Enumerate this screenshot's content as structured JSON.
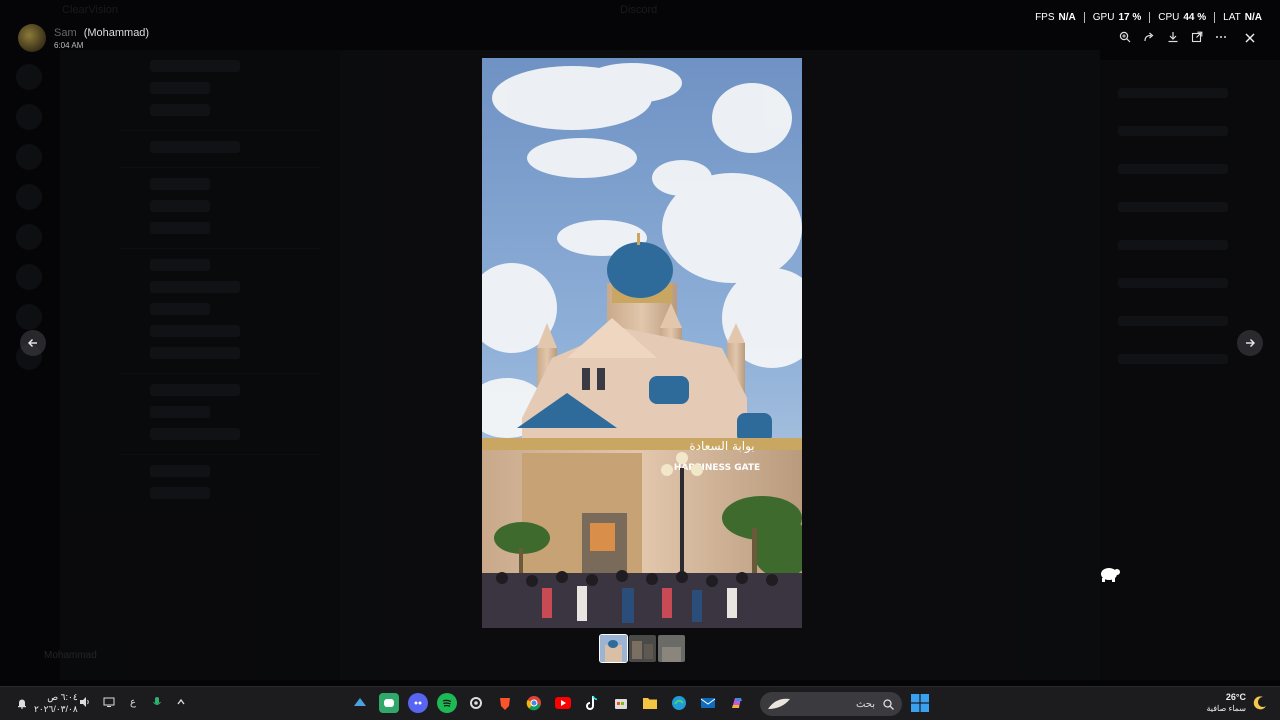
{
  "background_app": {
    "title": "ClearVision",
    "center_title": "Discord",
    "bottom_user": "Mohammad"
  },
  "user": {
    "handle": "Sam",
    "name": "(Mohammad)",
    "time": "6:04 AM"
  },
  "perf": {
    "fps_label": "FPS",
    "fps_value": "N/A",
    "gpu_label": "GPU",
    "gpu_value": "17 %",
    "cpu_label": "CPU",
    "cpu_value": "44 %",
    "lat_label": "LAT",
    "lat_value": "N/A"
  },
  "toolbar": {
    "zoom_icon": "zoom-in-icon",
    "forward_icon": "forward-icon",
    "download_icon": "download-icon",
    "open_icon": "open-external-icon",
    "more_icon": "more-icon",
    "close_icon": "close-icon"
  },
  "image": {
    "sign_text": "بوابة السعادة",
    "gate_text": "HAPPINESS GATE"
  },
  "thumbnails": [
    "thumb-1",
    "thumb-2",
    "thumb-3"
  ],
  "taskbar": {
    "time": "٦:٠٤ ص",
    "date": "٢٠٢٦/٠٣/٠٨",
    "lang": "ع",
    "search_placeholder": "بحث",
    "weather_temp": "26°C",
    "weather_desc": "سماء صافية",
    "apps": [
      "steam",
      "discord",
      "discord-alt",
      "spotify",
      "settings",
      "brave",
      "chrome",
      "youtube",
      "tiktok",
      "store",
      "files",
      "edge",
      "outlook",
      "copilot"
    ]
  },
  "colors": {
    "sky_top": "#7b9cc8",
    "dome": "#2f6b9a",
    "building": "#d9b99a",
    "taskbar": "#1c1c1f"
  }
}
